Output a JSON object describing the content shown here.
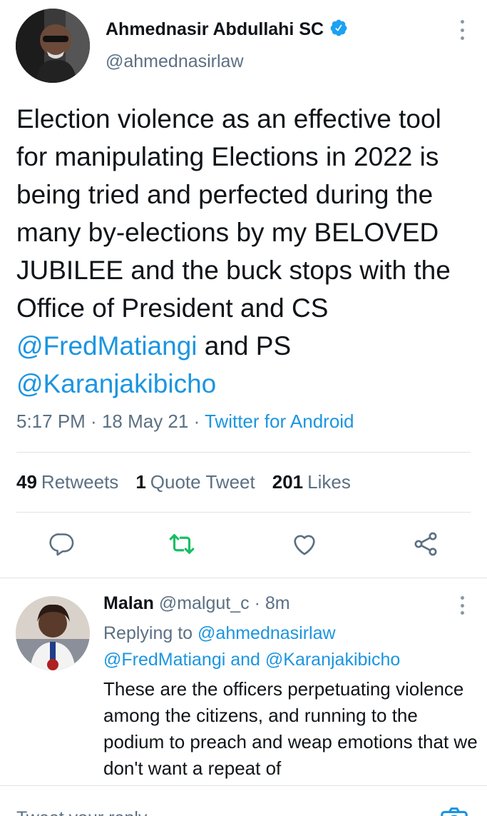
{
  "author": {
    "display_name": "Ahmednasir Abdullahi SC",
    "handle": "@ahmednasirlaw"
  },
  "tweet": {
    "text_plain": "Election violence as an effective tool for manipulating Elections in 2022 is being tried and perfected during the many by-elections by my BELOVED JUBILEE and the buck stops with the Office of President and CS ",
    "mention1": "@FredMatiangi",
    "text_mid": " and PS ",
    "mention2": "@Karanjakibicho",
    "time": "5:17 PM",
    "date": "18 May 21",
    "sep": " · ",
    "client": "Twitter for Android"
  },
  "stats": {
    "retweets_count": "49",
    "retweets_label": "Retweets",
    "quotes_count": "1",
    "quotes_label": "Quote Tweet",
    "likes_count": "201",
    "likes_label": "Likes"
  },
  "reply": {
    "name": "Malan",
    "handle": "@malgut_c",
    "age": "8m",
    "replying_prefix": "Replying to ",
    "replying_to_1": "@ahmednasirlaw",
    "replying_to_2": "@FredMatiangi",
    "and": " and ",
    "replying_to_3": "@Karanjakibicho",
    "text": "These are the officers perpetuating violence among the citizens, and running to the podium to preach and  weap emotions that we don't want a repeat of"
  },
  "composer": {
    "placeholder": "Tweet your reply"
  },
  "colors": {
    "link": "#1b95e0",
    "retweet_green": "#17bf63",
    "muted": "#5b7083",
    "verified": "#1da1f2"
  },
  "icons": [
    "verified-icon",
    "more-icon",
    "reply-icon",
    "retweet-icon",
    "like-icon",
    "share-icon",
    "camera-icon"
  ]
}
